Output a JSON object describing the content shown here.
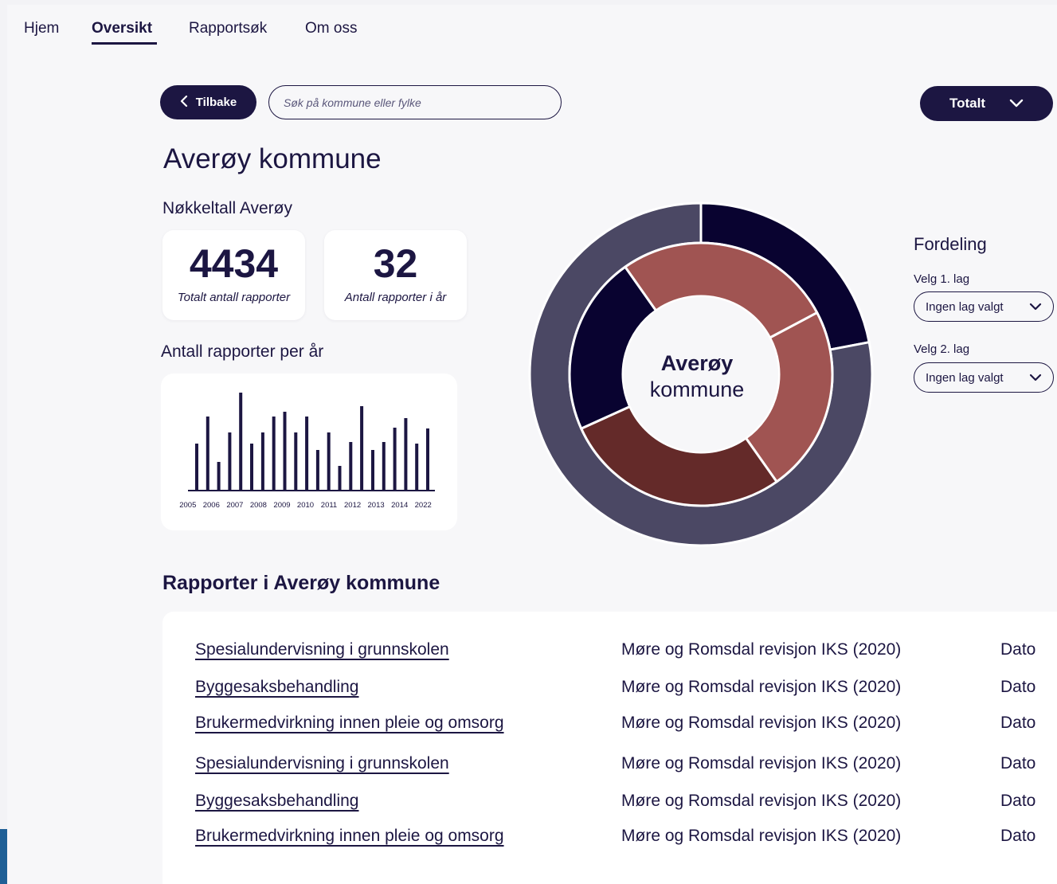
{
  "nav": {
    "items": [
      {
        "label": "Hjem",
        "active": false
      },
      {
        "label": "Oversikt",
        "active": true
      },
      {
        "label": "Rapportsøk",
        "active": false
      },
      {
        "label": "Om oss",
        "active": false
      }
    ]
  },
  "toolbar": {
    "back_label": "Tilbake",
    "search_placeholder": "Søk på kommune eller fylke",
    "total_label": "Totalt"
  },
  "page_title": "Averøy kommune",
  "key_figures": {
    "heading": "Nøkkeltall Averøy",
    "cards": [
      {
        "value": "4434",
        "label": "Totalt antall rapporter"
      },
      {
        "value": "32",
        "label": "Antall rapporter i år"
      }
    ]
  },
  "reports_per_year": {
    "heading": "Antall rapporter per år"
  },
  "chart_data": [
    {
      "type": "bar",
      "categories": [
        "2005",
        "2006",
        "2007",
        "2008",
        "2009",
        "2010",
        "2011",
        "2012",
        "2013",
        "2014",
        "2022"
      ],
      "values": [
        58,
        92,
        35,
        72,
        122,
        58,
        72,
        92,
        98,
        72,
        92,
        50,
        72,
        30,
        60,
        105,
        50,
        60,
        78,
        90,
        58,
        77
      ],
      "colors": {
        "bar": "#1c1642",
        "axis": "#1c1642"
      }
    },
    {
      "type": "pie",
      "center_label_line1": "Averøy",
      "center_label_line2": "kommune",
      "outer_ring": [
        {
          "value": 22,
          "color": "#090330"
        },
        {
          "value": 78,
          "color": "#4b4864"
        }
      ],
      "inner_ring": [
        {
          "value": 23,
          "color": "#a05452"
        },
        {
          "value": 28,
          "color": "#642a29"
        },
        {
          "value": 22,
          "color": "#090330"
        },
        {
          "value": 27,
          "color": "#a05452"
        }
      ]
    }
  ],
  "fordeling": {
    "title": "Fordeling",
    "layer1_label": "Velg 1. lag",
    "layer1_value": "Ingen lag valgt",
    "layer2_label": "Velg 2. lag",
    "layer2_value": "Ingen lag valgt"
  },
  "reports": {
    "heading": "Rapporter i Averøy kommune",
    "rows": [
      {
        "title": "Spesialundervisning i grunnskolen",
        "org": "Møre og Romsdal revisjon IKS (2020)",
        "date": "Dato"
      },
      {
        "title": "Byggesaksbehandling",
        "org": "Møre og Romsdal revisjon IKS (2020)",
        "date": "Dato"
      },
      {
        "title": "Brukermedvirkning innen pleie og omsorg",
        "org": "Møre og Romsdal revisjon IKS (2020)",
        "date": "Dato"
      },
      {
        "title": "Spesialundervisning i grunnskolen",
        "org": "Møre og Romsdal revisjon IKS (2020)",
        "date": "Dato"
      },
      {
        "title": "Byggesaksbehandling",
        "org": "Møre og Romsdal revisjon IKS (2020)",
        "date": "Dato"
      },
      {
        "title": "Brukermedvirkning innen pleie og omsorg",
        "org": "Møre og Romsdal revisjon IKS (2020)",
        "date": "Dato"
      }
    ]
  },
  "colors": {
    "primary": "#1c1642",
    "background": "#f7f7f9",
    "card": "#ffffff",
    "accent_left": "#1f5f96"
  }
}
